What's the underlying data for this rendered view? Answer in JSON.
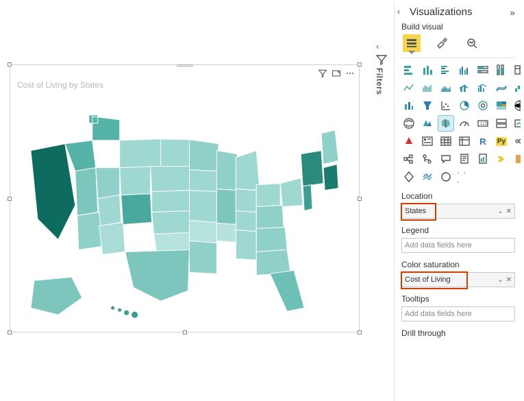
{
  "canvas": {
    "title": "Cost of Living by States"
  },
  "filters": {
    "label": "Filters"
  },
  "pane": {
    "title": "Visualizations",
    "subheader": "Build visual",
    "tabs": {
      "fields": "Fields",
      "format": "Format",
      "analytics": "Analytics"
    },
    "more_label": "· · ·",
    "wells": [
      {
        "label": "Location",
        "value": "States",
        "placeholder": false,
        "highlight": "hl-states"
      },
      {
        "label": "Legend",
        "value": "Add data fields here",
        "placeholder": true,
        "highlight": null
      },
      {
        "label": "Color saturation",
        "value": "Cost of Living",
        "placeholder": false,
        "highlight": "hl-col"
      },
      {
        "label": "Tooltips",
        "value": "Add data fields here",
        "placeholder": true,
        "highlight": null
      },
      {
        "label": "Drill through",
        "value": "",
        "placeholder": true,
        "highlight": null
      }
    ]
  },
  "viz_icons": [
    "stacked-bar",
    "stacked-column",
    "clustered-bar",
    "clustered-column",
    "100-bar",
    "100-column",
    "table-alt",
    "line",
    "area",
    "stacked-area",
    "line-stacked",
    "line-clustered",
    "ribbon",
    "waterfall",
    "funnel",
    "scatter",
    "pie",
    "donut",
    "treemap",
    "map",
    "filled-map",
    "azure-map",
    "shape-map",
    "gauge",
    "card",
    "multi-card",
    "kpi",
    "slicer",
    "table",
    "matrix",
    "r",
    "py",
    "key-influencers",
    "decomp",
    "qa",
    "paginated",
    "arcgis",
    "power-apps",
    "power-automate",
    "ai",
    "paginated2",
    "more"
  ],
  "viz_icon_row2": [
    "get-more",
    "import",
    "custom"
  ],
  "colors": {
    "map_light": "#a9dcd6",
    "map_mid": "#6ec0b7",
    "map_dark": "#2a8a7e",
    "map_darkest": "#0e6b5f"
  },
  "r_label": "R",
  "py_label": "Py"
}
